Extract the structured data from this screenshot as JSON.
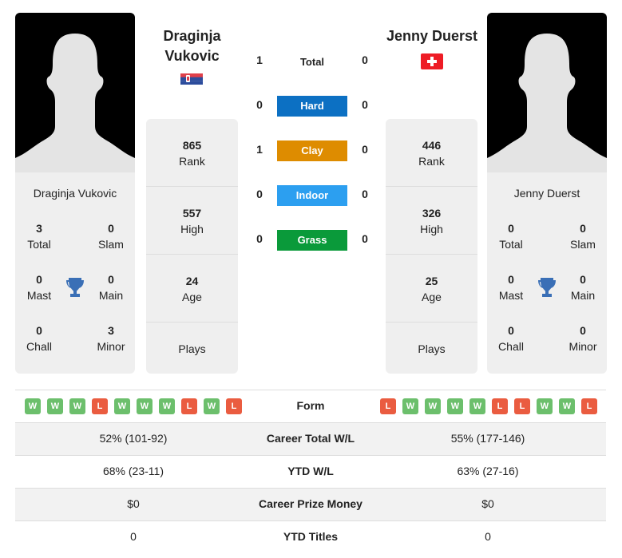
{
  "players": {
    "left": {
      "name_line1": "Draginja",
      "name_line2": "Vukovic",
      "full_name": "Draginja Vukovic",
      "country_flag": "serbia-flag",
      "titles": {
        "total": "3",
        "total_label": "Total",
        "slam": "0",
        "slam_label": "Slam",
        "mast": "0",
        "mast_label": "Mast",
        "main": "0",
        "main_label": "Main",
        "chall": "0",
        "chall_label": "Chall",
        "minor": "3",
        "minor_label": "Minor"
      },
      "rank": "865",
      "rank_label": "Rank",
      "high": "557",
      "high_label": "High",
      "age": "24",
      "age_label": "Age",
      "plays_label": "Plays",
      "form": [
        "W",
        "W",
        "W",
        "L",
        "W",
        "W",
        "W",
        "L",
        "W",
        "L"
      ]
    },
    "right": {
      "name": "Jenny Duerst",
      "full_name": "Jenny Duerst",
      "country_flag": "switzerland-flag",
      "titles": {
        "total": "0",
        "total_label": "Total",
        "slam": "0",
        "slam_label": "Slam",
        "mast": "0",
        "mast_label": "Mast",
        "main": "0",
        "main_label": "Main",
        "chall": "0",
        "chall_label": "Chall",
        "minor": "0",
        "minor_label": "Minor"
      },
      "rank": "446",
      "rank_label": "Rank",
      "high": "326",
      "high_label": "High",
      "age": "25",
      "age_label": "Age",
      "plays_label": "Plays",
      "form": [
        "L",
        "W",
        "W",
        "W",
        "W",
        "L",
        "L",
        "W",
        "W",
        "L"
      ]
    }
  },
  "h2h": {
    "total": {
      "label": "Total",
      "left": "1",
      "right": "0"
    },
    "surfaces": [
      {
        "label": "Hard",
        "left": "0",
        "right": "0",
        "color": "#0c70c3"
      },
      {
        "label": "Clay",
        "left": "1",
        "right": "0",
        "color": "#de8c00"
      },
      {
        "label": "Indoor",
        "left": "0",
        "right": "0",
        "color": "#2c9ff0"
      },
      {
        "label": "Grass",
        "left": "0",
        "right": "0",
        "color": "#0a9a3a"
      }
    ]
  },
  "comparison": {
    "form_label": "Form",
    "rows": [
      {
        "label": "Career Total W/L",
        "left": "52% (101-92)",
        "right": "55% (177-146)"
      },
      {
        "label": "YTD W/L",
        "left": "68% (23-11)",
        "right": "63% (27-16)"
      },
      {
        "label": "Career Prize Money",
        "left": "$0",
        "right": "$0"
      },
      {
        "label": "YTD Titles",
        "left": "0",
        "right": "0"
      }
    ]
  }
}
